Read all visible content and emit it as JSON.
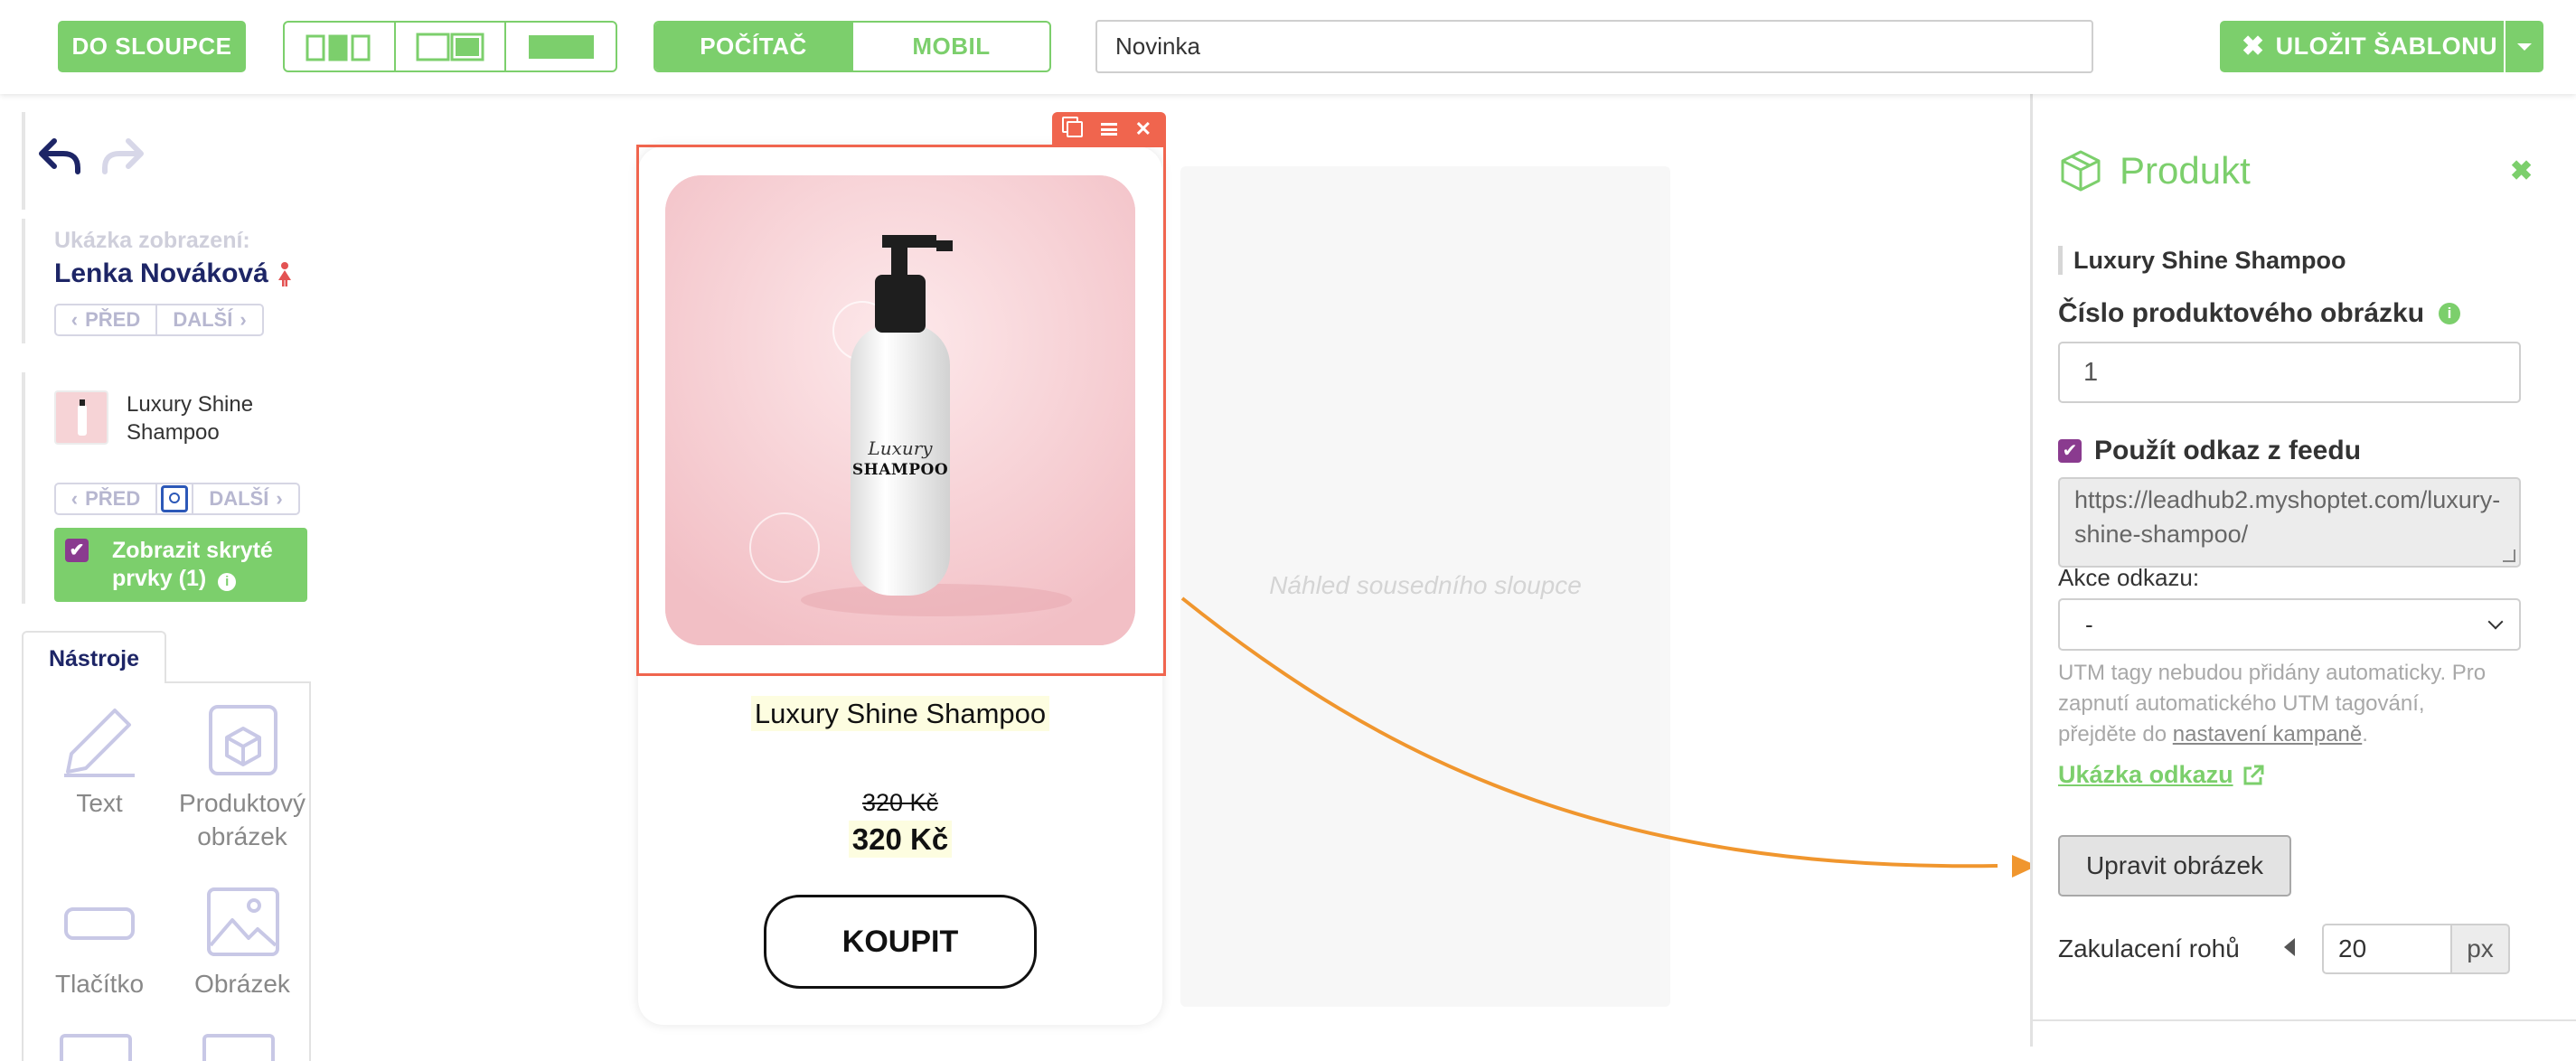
{
  "toolbar": {
    "to_columns": "DO SLOUPCE",
    "device_desktop": "POČÍTAČ",
    "device_mobile": "MOBIL",
    "template_name": "Novinka",
    "save_template": "ULOŽIT ŠABLONU"
  },
  "preview": {
    "label": "Ukázka zobrazení:",
    "contact_name": "Lenka Nováková",
    "prev": "PŘED",
    "next": "DALŠÍ"
  },
  "product_preview": {
    "name": "Luxury Shine Shampoo",
    "prev": "PŘED",
    "next": "DALŠÍ"
  },
  "hidden_toggle": {
    "label": "Zobrazit skryté prvky (1)",
    "checked": true
  },
  "tools": {
    "tab": "Nástroje",
    "items": [
      {
        "label": "Text",
        "icon": "pencil-icon"
      },
      {
        "label": "Produktový obrázek",
        "icon": "product-image-icon"
      },
      {
        "label": "Tlačítko",
        "icon": "button-icon"
      },
      {
        "label": "Obrázek",
        "icon": "image-icon"
      }
    ]
  },
  "canvas": {
    "product_title": "Luxury Shine Shampoo",
    "old_price": "320 Kč",
    "price": "320 Kč",
    "buy_button": "KOUPIT",
    "neighbor_placeholder": "Náhled sousedního sloupce",
    "bottle_label_script": "Luxury",
    "bottle_label": "SHAMPOO"
  },
  "panel": {
    "title": "Produkt",
    "product_name": "Luxury Shine Shampoo",
    "image_number_label": "Číslo produktového obrázku",
    "image_number_value": "1",
    "use_feed_link_label": "Použít odkaz z feedu",
    "use_feed_link_checked": true,
    "link_url": "https://leadhub2.myshoptet.com/luxury-shine-shampoo/",
    "link_action_label": "Akce odkazu:",
    "link_action_value": "-",
    "utm_note_1": "UTM tagy nebudou přidány automaticky. Pro",
    "utm_note_2": "zapnutí automatického UTM tagování,",
    "utm_note_3": "přejděte do ",
    "utm_note_link": "nastavení kampaně",
    "utm_note_end": ".",
    "link_preview": "Ukázka odkazu",
    "edit_image": "Upravit obrázek",
    "corner_radius_label": "Zakulacení rohů",
    "corner_radius_value": "20",
    "corner_radius_unit": "px"
  },
  "colors": {
    "accent_green": "#7ccf6c",
    "selection_red": "#f0654e",
    "arrow_orange": "#f0962e",
    "navy": "#1d2566"
  }
}
